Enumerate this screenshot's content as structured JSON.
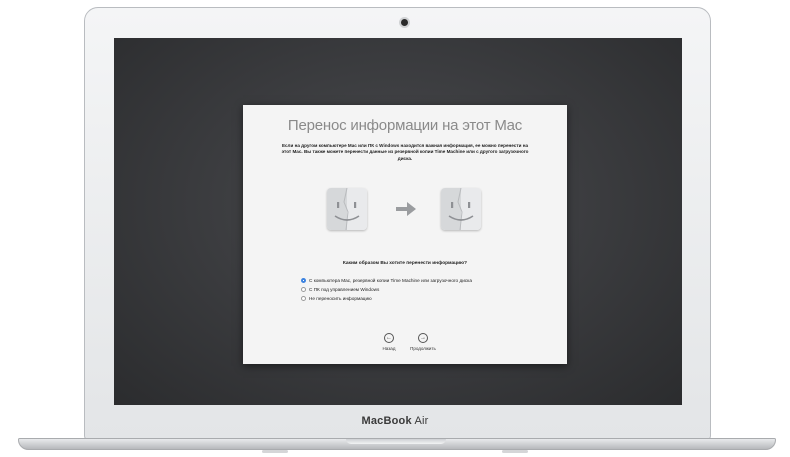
{
  "device": {
    "brand": "MacBook",
    "model": "Air"
  },
  "migration_assistant": {
    "title": "Перенос информации на этот Mac",
    "description": "Если на другом компьютере Mac или ПК с Windows находится важная информация, ее можно перенести на этот Mac. Вы также можете перенести данные из резервной копии Time Machine или с другого загрузочного диска.",
    "question": "Каким образом Вы хотите перенести информацию?",
    "options": [
      {
        "label": "С компьютера Mac, резервной копии Time Machine или загрузочного диска",
        "selected": true
      },
      {
        "label": "С ПК под управлением Windows",
        "selected": false
      },
      {
        "label": "Не переносить информацию",
        "selected": false
      }
    ],
    "back_label": "Назад",
    "continue_label": "Продолжить",
    "icons": [
      "finder-icon",
      "right-arrow-icon",
      "finder-icon"
    ]
  },
  "colors": {
    "screen_background": "#3c3d40",
    "radio_selected": "#3b82e0",
    "window_background": "#f4f4f4"
  }
}
